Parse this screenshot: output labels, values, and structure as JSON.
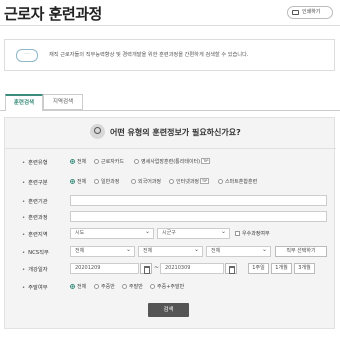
{
  "header": {
    "title": "근로자 훈련과정",
    "print_label": "인쇄하기"
  },
  "info": {
    "icon_label": "···",
    "text": "재직 근로자들의 직무능력향상 및 경력개발을 위한 훈련과정을 간편하게 검색할 수 있습니다."
  },
  "tabs": [
    {
      "label": "훈련검색"
    },
    {
      "label": "지역검색"
    }
  ],
  "search": {
    "question": "어떤 유형의 훈련정보가 필요하신가요?",
    "type": {
      "label": "훈련유형",
      "options": [
        "전체",
        "근로자카드",
        "영세사업장훈련(통리테이터)"
      ],
      "tip": "TIP"
    },
    "category": {
      "label": "훈련구분",
      "options": [
        "전체",
        "일반과정",
        "외국어과정",
        "인터넷과정",
        "스마트혼합훈련"
      ],
      "tip": "TIP"
    },
    "institution": {
      "label": "훈련기관",
      "value": ""
    },
    "course": {
      "label": "훈련과정",
      "value": ""
    },
    "region": {
      "label": "훈련지역",
      "sido": "시도",
      "sigungu": "시군구",
      "checkbox": "우수과정여부"
    },
    "ncs": {
      "label": "NCS직무",
      "select1": "전체",
      "select2": "전체",
      "select3": "전체",
      "button": "직무 선택하기"
    },
    "period": {
      "label": "개강일자",
      "start": "20201209",
      "end": "20210309",
      "btn1": "1주일",
      "btn2": "1개월",
      "btn3": "3개월"
    },
    "weekend": {
      "label": "주말여부",
      "options": [
        "전체",
        "주중반",
        "주말반",
        "주중+주말반"
      ]
    },
    "submit": "검색"
  }
}
